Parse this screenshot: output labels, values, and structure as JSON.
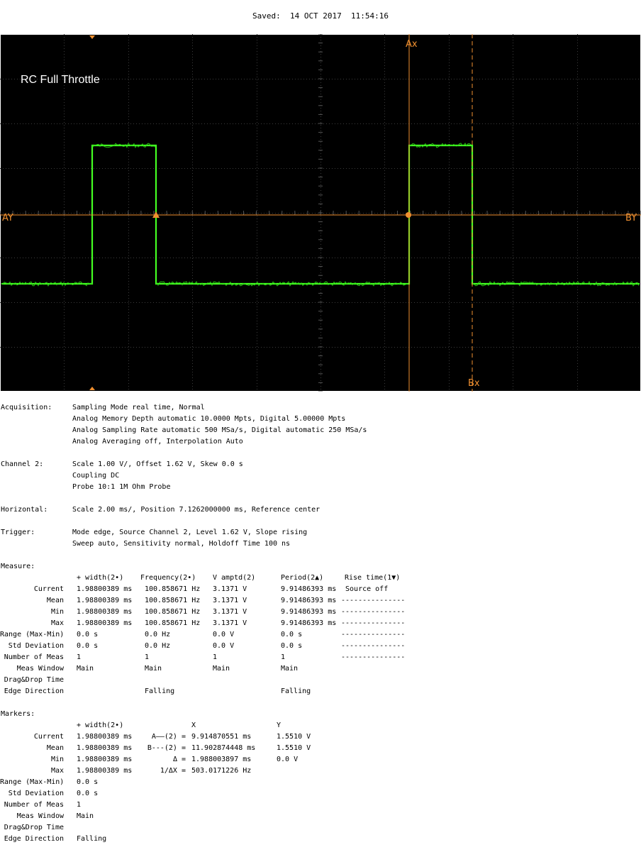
{
  "saved": "Saved:  14 OCT 2017  11:54:16",
  "screen": {
    "annotation": "RC Full Throttle",
    "cursor_labels": {
      "ax": "Ax",
      "bx": "Bx",
      "ay": "AY",
      "by": "BY"
    },
    "colors": {
      "background": "#000000",
      "grid": "#3a3a3a",
      "trace": "#44ff22",
      "cursor": "#f09030",
      "label": "#ffffff"
    }
  },
  "acquisition": {
    "label": "Acquisition:",
    "lines": [
      "Sampling Mode real time, Normal",
      "Analog Memory Depth automatic 10.0000 Mpts, Digital 5.00000 Mpts",
      "Analog Sampling Rate automatic 500 MSa/s, Digital automatic 250 MSa/s",
      "Analog Averaging off, Interpolation Auto"
    ]
  },
  "channel2": {
    "label": "Channel 2:",
    "lines": [
      "Scale 1.00 V/, Offset 1.62 V, Skew 0.0 s",
      "Coupling DC",
      "Probe 10:1 1M Ohm Probe"
    ]
  },
  "horizontal": {
    "label": "Horizontal:",
    "lines": [
      "Scale 2.00 ms/, Position 7.1262000000 ms, Reference center"
    ]
  },
  "trigger": {
    "label": "Trigger:",
    "lines": [
      "Mode edge, Source Channel 2, Level 1.62 V, Slope rising",
      "Sweep auto, Sensitivity normal, Holdoff Time 100 ns"
    ]
  },
  "measure": {
    "label": "Measure:",
    "headers": [
      "+ width(2•)",
      "Frequency(2•)",
      "V amptd(2)",
      "Period(2▲)",
      "Rise time(1▼)"
    ],
    "rows": [
      {
        "label": "Current",
        "cells": [
          "1.98800389 ms",
          "100.858671 Hz",
          "3.1371 V",
          "9.91486393 ms",
          " Source off"
        ]
      },
      {
        "label": "Mean",
        "cells": [
          "1.98800389 ms",
          "100.858671 Hz",
          "3.1371 V",
          "9.91486393 ms",
          "---------------"
        ]
      },
      {
        "label": "Min",
        "cells": [
          "1.98800389 ms",
          "100.858671 Hz",
          "3.1371 V",
          "9.91486393 ms",
          "---------------"
        ]
      },
      {
        "label": "Max",
        "cells": [
          "1.98800389 ms",
          "100.858671 Hz",
          "3.1371 V",
          "9.91486393 ms",
          "---------------"
        ]
      },
      {
        "label": "Range (Max-Min)",
        "cells": [
          "0.0 s",
          "0.0 Hz",
          "0.0 V",
          "0.0 s",
          "---------------"
        ]
      },
      {
        "label": "Std Deviation",
        "cells": [
          "0.0 s",
          "0.0 Hz",
          "0.0 V",
          "0.0 s",
          "---------------"
        ]
      },
      {
        "label": "Number of Meas",
        "cells": [
          "1",
          "1",
          "1",
          "1",
          "---------------"
        ]
      },
      {
        "label": "Meas Window",
        "cells": [
          "Main",
          "Main",
          "Main",
          "Main",
          ""
        ]
      },
      {
        "label": "Drag&Drop Time",
        "cells": [
          "",
          "",
          "",
          "",
          ""
        ]
      },
      {
        "label": "Edge Direction",
        "cells": [
          "",
          "Falling",
          "",
          "Falling",
          ""
        ]
      }
    ]
  },
  "markers": {
    "label": "Markers:",
    "headers": {
      "width": "+ width(2•)",
      "x": "X",
      "y": "Y"
    },
    "rows": [
      {
        "label": "Current",
        "width": "1.98800389 ms",
        "xlabel": "A——(2) =",
        "x": "9.914870551 ms",
        "y": "1.5510 V"
      },
      {
        "label": "Mean",
        "width": "1.98800389 ms",
        "xlabel": "B---(2) =",
        "x": "11.902874448 ms",
        "y": "1.5510 V"
      },
      {
        "label": "Min",
        "width": "1.98800389 ms",
        "xlabel": "Δ =",
        "x": "1.988003897 ms",
        "y": "0.0 V"
      },
      {
        "label": "Max",
        "width": "1.98800389 ms",
        "xlabel": "1/ΔX =",
        "x": "503.0171226 Hz",
        "y": ""
      },
      {
        "label": "Range (Max-Min)",
        "width": "0.0 s",
        "xlabel": "",
        "x": "",
        "y": ""
      },
      {
        "label": "Std Deviation",
        "width": "0.0 s",
        "xlabel": "",
        "x": "",
        "y": ""
      },
      {
        "label": "Number of Meas",
        "width": "1",
        "xlabel": "",
        "x": "",
        "y": ""
      },
      {
        "label": "Meas Window",
        "width": "Main",
        "xlabel": "",
        "x": "",
        "y": ""
      },
      {
        "label": "Drag&Drop Time",
        "width": "",
        "xlabel": "",
        "x": "",
        "y": ""
      },
      {
        "label": "Edge Direction",
        "width": "Falling",
        "xlabel": "",
        "x": "",
        "y": ""
      }
    ]
  }
}
